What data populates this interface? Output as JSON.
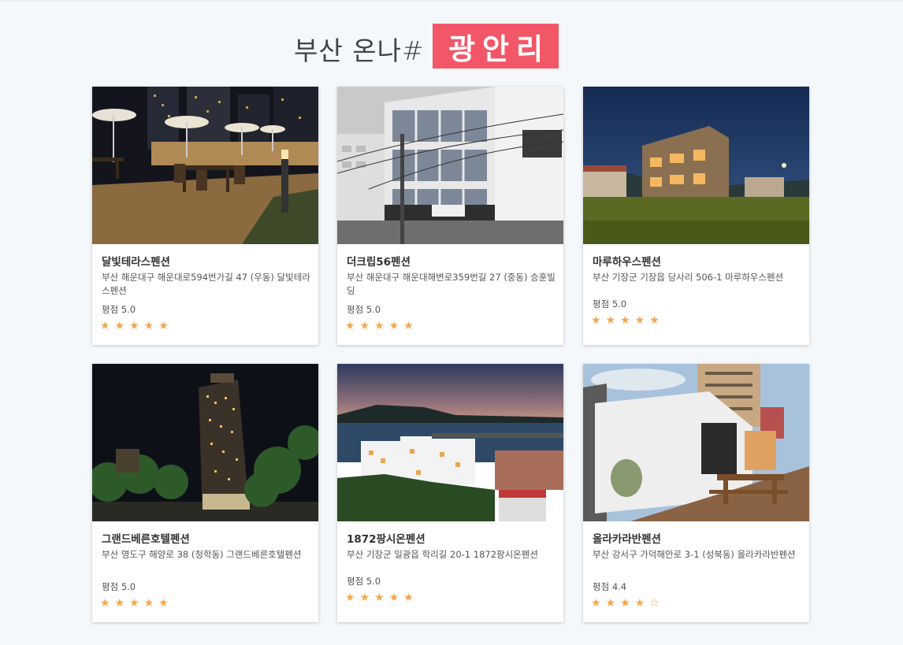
{
  "header": {
    "title_prefix": "부산 온나#",
    "title_highlight": "광안리",
    "highlight_color": "#f25767"
  },
  "star_color": "#f3a64e",
  "cards": [
    {
      "name": "달빛테라스펜션",
      "address": "부산 해운대구 해운대로594번가길 47 (우동) 달빛테라스펜션",
      "rating_label": "평점 5.0",
      "stars": "★★★★★",
      "rating": 5.0
    },
    {
      "name": "더크립56펜션",
      "address": "부산 해운대구 해운대해변로359번길 27 (중동) 승훈빌딩",
      "rating_label": "평점 5.0",
      "stars": "★★★★★",
      "rating": 5.0
    },
    {
      "name": "마루하우스펜션",
      "address": "부산 기장군 기장읍 당사리 506-1 마루하우스펜션",
      "rating_label": "평점 5.0",
      "stars": "★★★★★",
      "rating": 5.0
    },
    {
      "name": "그랜드베른호텔펜션",
      "address": "부산 영도구 해양로 38 (청학동) 그랜드베른호텔펜션",
      "rating_label": "평점 5.0",
      "stars": "★★★★★",
      "rating": 5.0
    },
    {
      "name": "1872팡시온펜션",
      "address": "부산 기장군 일광읍 학리길 20-1 1872팡시온펜션",
      "rating_label": "평점 5.0",
      "stars": "★★★★★",
      "rating": 5.0
    },
    {
      "name": "올라카라반펜션",
      "address": "부산 강서구 가덕해안로 3-1 (성북동) 올라카라반펜션",
      "rating_label": "평점 4.4",
      "stars": "★★★★☆",
      "rating": 4.4
    }
  ]
}
